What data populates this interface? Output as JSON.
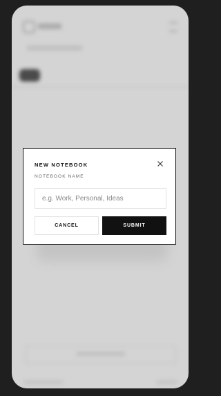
{
  "modal": {
    "title": "NEW NOTEBOOK",
    "field_label": "NOTEBOOK NAME",
    "input_placeholder": "e.g. Work, Personal, Ideas",
    "input_value": "",
    "cancel_label": "CANCEL",
    "submit_label": "SUBMIT",
    "close_icon": "close-icon"
  },
  "colors": {
    "backdrop": "#1f1f1f",
    "overlay": "#d4d4d4",
    "modal_bg": "#ffffff",
    "primary": "#111111"
  }
}
